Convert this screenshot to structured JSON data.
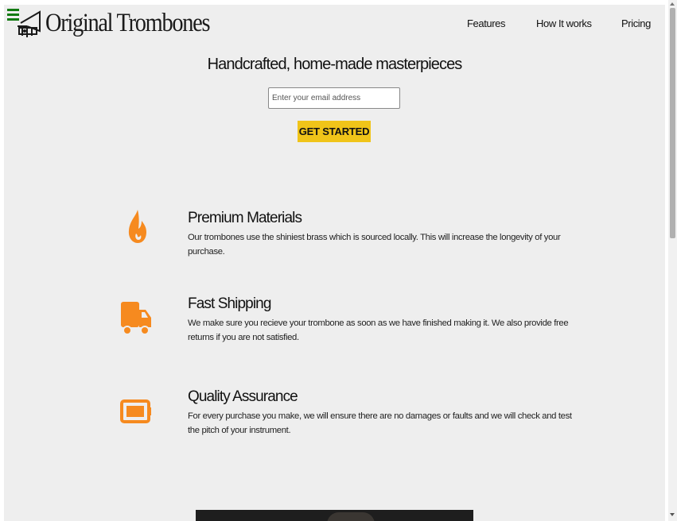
{
  "header": {
    "logo_text": "Original Trombones",
    "nav": [
      {
        "label": "Features"
      },
      {
        "label": "How It works"
      },
      {
        "label": "Pricing"
      }
    ]
  },
  "hero": {
    "title": "Handcrafted, home-made masterpieces",
    "email_placeholder": "Enter your email address",
    "cta_label": "GET STARTED"
  },
  "features": [
    {
      "icon": "fire-icon",
      "title": "Premium Materials",
      "text": "Our trombones use the shiniest brass which is sourced locally. This will increase the longevity of your purchase."
    },
    {
      "icon": "truck-icon",
      "title": "Fast Shipping",
      "text": "We make sure you recieve your trombone as soon as we have finished making it. We also provide free returns if you are not satisfied."
    },
    {
      "icon": "battery-icon",
      "title": "Quality Assurance",
      "text": "For every purchase you make, we will ensure there are no damages or faults and we will check and test the pitch of your instrument."
    }
  ],
  "colors": {
    "accent_icon": "#f68a1f",
    "cta_background": "#f0c419",
    "menu_icon": "#127a12",
    "page_background": "#eeeeee"
  }
}
